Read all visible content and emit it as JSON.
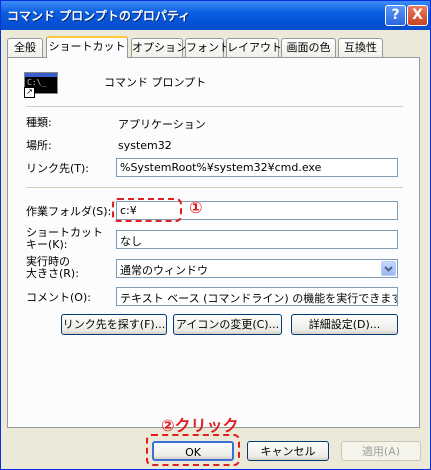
{
  "window": {
    "title": "コマンド プロンプトのプロパティ",
    "help_glyph": "?",
    "close_glyph": "X"
  },
  "tabs": [
    {
      "label": "全般"
    },
    {
      "label": "ショートカット"
    },
    {
      "label": "オプション"
    },
    {
      "label": "フォント"
    },
    {
      "label": "レイアウト"
    },
    {
      "label": "画面の色"
    },
    {
      "label": "互換性"
    }
  ],
  "header": {
    "icon_name": "command-prompt-icon",
    "icon_text": "C:\\_",
    "name": "コマンド プロンプト"
  },
  "fields": {
    "type_label": "種類:",
    "type_value": "アプリケーション",
    "location_label": "場所:",
    "location_value": "system32",
    "target_label": "リンク先(T):",
    "target_value": "%SystemRoot%¥system32¥cmd.exe",
    "startin_label": "作業フォルダ(S):",
    "startin_value": "c:¥",
    "shortcut_label_1": "ショートカット",
    "shortcut_label_2": "キー(K):",
    "shortcut_value": "なし",
    "run_label_1": "実行時の",
    "run_label_2": "大きさ(R):",
    "run_value": "通常のウィンドウ",
    "comment_label": "コメント(O):",
    "comment_value": "テキスト ベース (コマンドライン) の機能を実行できます。"
  },
  "panel_buttons": {
    "find_target": "リンク先を探す(F)...",
    "change_icon": "アイコンの変更(C)...",
    "advanced": "詳細設定(D)..."
  },
  "footer": {
    "ok": "OK",
    "cancel": "キャンセル",
    "apply": "適用(A)"
  },
  "annotations": {
    "step1": "①",
    "step2": "②クリック",
    "color": "#e02020"
  }
}
